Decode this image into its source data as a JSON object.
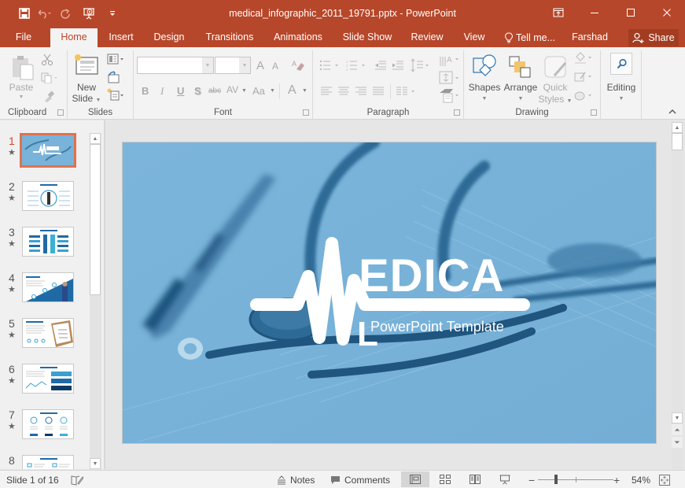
{
  "window": {
    "title": "medical_infographic_2011_19791.pptx - PowerPoint",
    "controls": {
      "restore_ribbon": "ribbon-display-options",
      "minimize": "minimize",
      "maximize": "maximize",
      "close": "close"
    }
  },
  "qat": {
    "items": [
      {
        "name": "save",
        "icon": "save-icon"
      },
      {
        "name": "undo",
        "icon": "undo-icon"
      },
      {
        "name": "redo",
        "icon": "redo-icon"
      },
      {
        "name": "start-from-beginning",
        "icon": "presentation-icon"
      },
      {
        "name": "customize",
        "icon": "customize-qat-icon"
      }
    ]
  },
  "tabs": [
    {
      "label": "File"
    },
    {
      "label": "Home",
      "active": true
    },
    {
      "label": "Insert"
    },
    {
      "label": "Design"
    },
    {
      "label": "Transitions"
    },
    {
      "label": "Animations"
    },
    {
      "label": "Slide Show"
    },
    {
      "label": "Review"
    },
    {
      "label": "View"
    }
  ],
  "tell_me": "Tell me...",
  "user": "Farshad Iq...",
  "share": "Share",
  "ribbon": {
    "clipboard": {
      "label": "Clipboard",
      "paste": "Paste"
    },
    "slides": {
      "label": "Slides",
      "new_slide_line1": "New",
      "new_slide_line2": "Slide"
    },
    "font": {
      "label": "Font",
      "font_name": "",
      "font_size": "",
      "bold": "B",
      "italic": "I",
      "underline": "U",
      "shadow": "S",
      "strike": "abc",
      "spacing": "AV",
      "change_case": "Aa",
      "font_color": "A",
      "grow": "A",
      "shrink": "A"
    },
    "paragraph": {
      "label": "Paragraph"
    },
    "drawing": {
      "label": "Drawing",
      "shapes": "Shapes",
      "arrange": "Arrange",
      "quick_styles_line1": "Quick",
      "quick_styles_line2": "Styles"
    },
    "editing": {
      "label": "Editing"
    }
  },
  "thumbnails": [
    {
      "num": "1",
      "active": true
    },
    {
      "num": "2"
    },
    {
      "num": "3"
    },
    {
      "num": "4"
    },
    {
      "num": "5"
    },
    {
      "num": "6"
    },
    {
      "num": "7"
    },
    {
      "num": "8"
    }
  ],
  "slide": {
    "title_rest": "EDICA",
    "title_first": "M",
    "title_last": "L",
    "subtitle": "PowerPoint Template",
    "bg_color": "#7ab3d9"
  },
  "status": {
    "slide_info": "Slide 1 of 16",
    "notes": "Notes",
    "comments": "Comments",
    "zoom": "54%",
    "zoom_percent": 54
  },
  "colors": {
    "accent": "#b7472a",
    "active_thumb_border": "#e0714f"
  }
}
